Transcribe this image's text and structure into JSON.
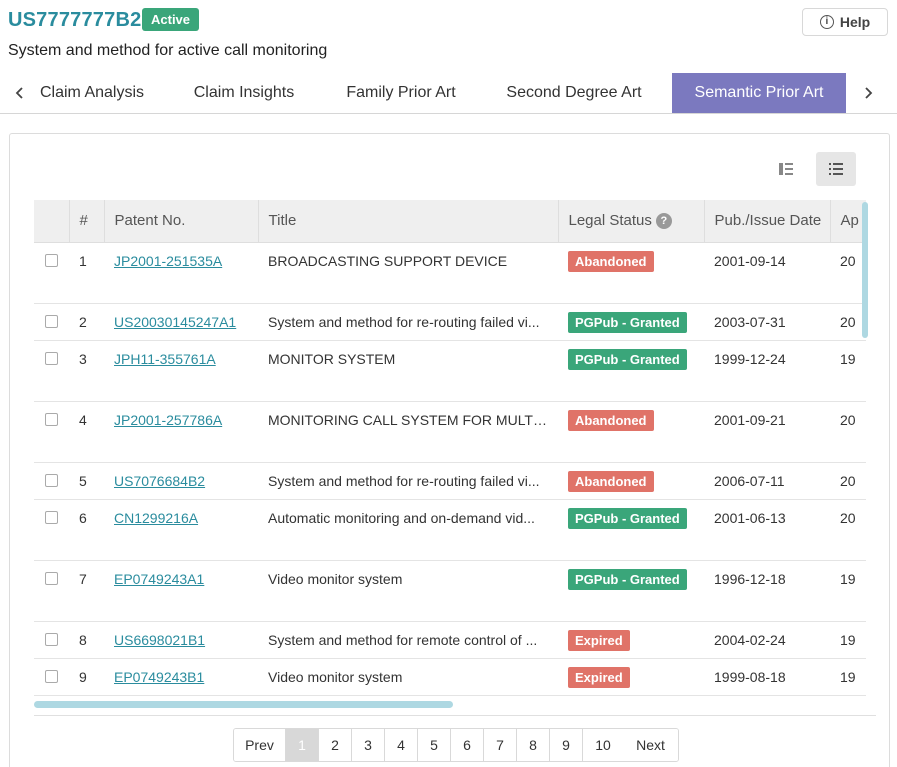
{
  "header": {
    "patent_id": "US7777777B2",
    "status": "Active",
    "help_label": "Help",
    "subtitle": "System and method for active call monitoring"
  },
  "tabs": [
    {
      "label": "Claim Analysis",
      "active": false
    },
    {
      "label": "Claim Insights",
      "active": false
    },
    {
      "label": "Family Prior Art",
      "active": false
    },
    {
      "label": "Second Degree Art",
      "active": false
    },
    {
      "label": "Semantic Prior Art",
      "active": true
    }
  ],
  "table": {
    "columns": [
      "#",
      "Patent No.",
      "Title",
      "Legal Status",
      "Pub./Issue Date",
      "Ap"
    ],
    "rows": [
      {
        "n": "1",
        "patent": "JP2001-251535A",
        "title": "BROADCASTING SUPPORT DEVICE",
        "status": "Abandoned",
        "date": "2001-09-14",
        "ap": "20"
      },
      {
        "n": "2",
        "patent": "US20030145247A1",
        "title": "System and method for re-routing failed vi...",
        "status": "PGPub - Granted",
        "date": "2003-07-31",
        "ap": "20"
      },
      {
        "n": "3",
        "patent": "JPH11-355761A",
        "title": "MONITOR SYSTEM",
        "status": "PGPub - Granted",
        "date": "1999-12-24",
        "ap": "19"
      },
      {
        "n": "4",
        "patent": "JP2001-257786A",
        "title": "MONITORING CALL SYSTEM FOR MULTI...",
        "status": "Abandoned",
        "date": "2001-09-21",
        "ap": "20"
      },
      {
        "n": "5",
        "patent": "US7076684B2",
        "title": "System and method for re-routing failed vi...",
        "status": "Abandoned",
        "date": "2006-07-11",
        "ap": "20"
      },
      {
        "n": "6",
        "patent": "CN1299216A",
        "title": "Automatic monitoring and on-demand vid...",
        "status": "PGPub - Granted",
        "date": "2001-06-13",
        "ap": "20"
      },
      {
        "n": "7",
        "patent": "EP0749243A1",
        "title": "Video monitor system",
        "status": "PGPub - Granted",
        "date": "1996-12-18",
        "ap": "19"
      },
      {
        "n": "8",
        "patent": "US6698021B1",
        "title": "System and method for remote control of ...",
        "status": "Expired",
        "date": "2004-02-24",
        "ap": "19"
      },
      {
        "n": "9",
        "patent": "EP0749243B1",
        "title": "Video monitor system",
        "status": "Expired",
        "date": "1999-08-18",
        "ap": "19"
      }
    ]
  },
  "status_colors": {
    "Abandoned": "#e07368",
    "PGPub - Granted": "#3aa67a",
    "Expired": "#e07368"
  },
  "pagination": {
    "prev": "Prev",
    "next": "Next",
    "pages": [
      "1",
      "2",
      "3",
      "4",
      "5",
      "6",
      "7",
      "8",
      "9",
      "10"
    ],
    "current": "1"
  },
  "icons": {
    "help": "question-circle-icon",
    "tab_prev": "chevron-left-icon",
    "tab_next": "chevron-right-icon",
    "view_grid": "column-view-icon",
    "view_list": "list-view-icon"
  }
}
